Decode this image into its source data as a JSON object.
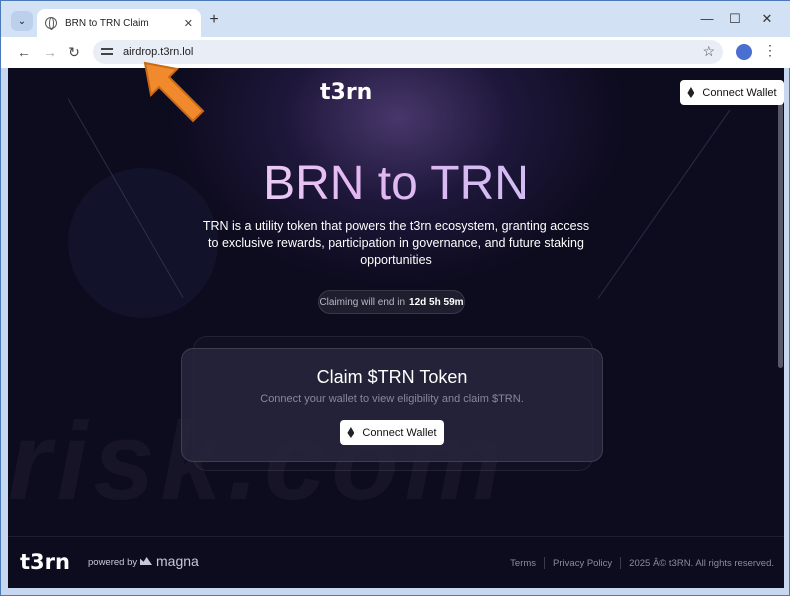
{
  "browser": {
    "tab_title": "BRN to TRN Claim",
    "tab_close": "✕",
    "new_tab": "+",
    "url": "airdrop.t3rn.lol",
    "controls": {
      "minimize": "—",
      "maximize": "☐",
      "close": "✕"
    },
    "nav": {
      "back": "←",
      "forward": "→",
      "reload": "↻"
    },
    "star": "☆",
    "menu": "⋮",
    "tab_menu": "⌄"
  },
  "page": {
    "logo": "t3rn",
    "connect_wallet_top": "Connect Wallet",
    "hero_title": "BRN to TRN",
    "hero_description": "TRN is a utility token that powers the t3rn ecosystem, granting access to exclusive rewards, participation in governance, and future staking opportunities",
    "countdown_label": "Claiming will end in",
    "countdown_value": "12d 5h 59m",
    "card": {
      "title": "Claim $TRN Token",
      "subtitle": "Connect your wallet to view eligibility and claim $TRN.",
      "button": "Connect Wallet"
    },
    "footer": {
      "logo": "t3rn",
      "powered_by": "powered by",
      "partner": "magna",
      "links": [
        "Terms",
        "Privacy Policy",
        "2025 Â© t3RN. All rights reserved."
      ]
    },
    "watermark": "risk.com"
  },
  "colors": {
    "page_bg": "#0d0b1e",
    "annotation_arrow": "#f08a2c"
  }
}
